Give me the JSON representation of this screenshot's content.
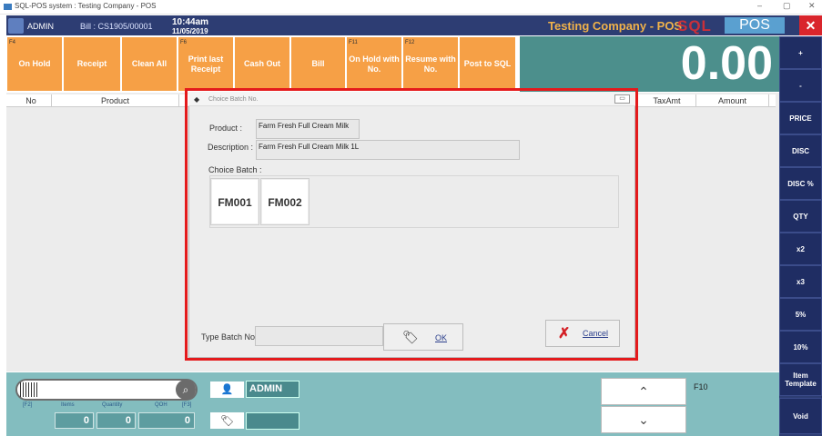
{
  "window": {
    "title": "SQL-POS system : Testing Company - POS",
    "minimize": "–",
    "maximize": "▢",
    "close": "✕"
  },
  "header": {
    "user": "ADMIN",
    "bill": "Bill : CS1905/00001",
    "time": "10:44am",
    "date": "11/05/2019",
    "company": "Testing Company - POS",
    "logo_left": "SQL",
    "logo_right": "POS",
    "close": "✕"
  },
  "function_buttons": [
    {
      "key": "F4",
      "label": "On Hold"
    },
    {
      "key": "",
      "label": "Receipt"
    },
    {
      "key": "",
      "label": "Clean All"
    },
    {
      "key": "F6",
      "label": "Print last Receipt"
    },
    {
      "key": "",
      "label": "Cash Out"
    },
    {
      "key": "",
      "label": "Bill"
    },
    {
      "key": "F11",
      "label": "On Hold with No."
    },
    {
      "key": "F12",
      "label": "Resume with No."
    },
    {
      "key": "",
      "label": "Post to SQL"
    }
  ],
  "total": "0.00",
  "sidebar": [
    "+",
    "-",
    "PRICE",
    "DISC",
    "DISC %",
    "QTY",
    "x2",
    "x3",
    "5%",
    "10%",
    "Item Template",
    "Void"
  ],
  "grid": {
    "columns": [
      "No",
      "Product",
      "TaxAmt",
      "Amount"
    ]
  },
  "bottom": {
    "f2": "[F2]",
    "items_label": "Items",
    "quantity_label": "Quantity",
    "qoh_label": "QOH",
    "f3": "[F3]",
    "items": "0",
    "quantity": "0",
    "qoh": "0",
    "user": "ADMIN",
    "up": "⌃",
    "down": "⌄",
    "f10": "F10"
  },
  "dialog": {
    "title": "Choice Batch No.",
    "product_label": "Product :",
    "product_value": "Farm Fresh Full Cream Milk",
    "description_label": "Description :",
    "description_value": "Farm Fresh Full Cream Milk 1L",
    "choice_batch_label": "Choice Batch :",
    "batches": [
      "FM001",
      "FM002"
    ],
    "type_batch_label": "Type Batch No.",
    "type_batch_value": "",
    "ok": "OK",
    "cancel": "Cancel"
  }
}
